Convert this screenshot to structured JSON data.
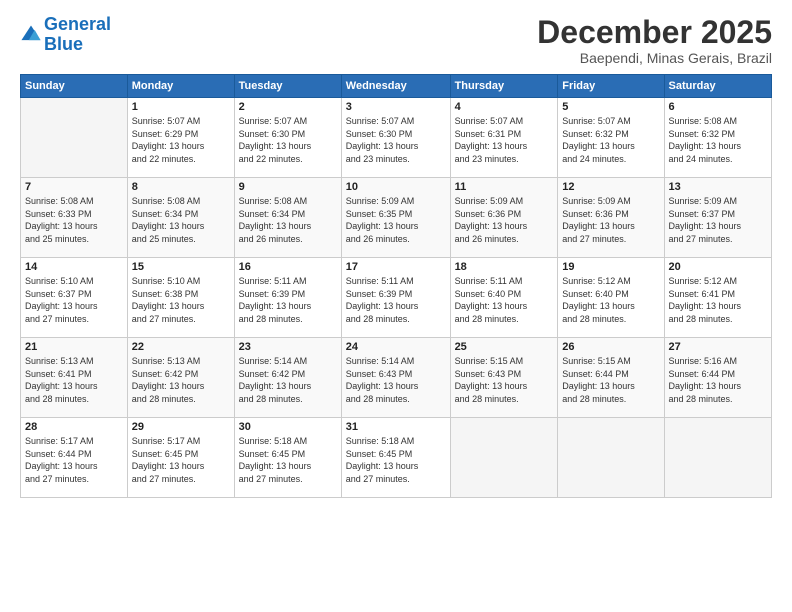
{
  "logo": {
    "line1": "General",
    "line2": "Blue"
  },
  "header": {
    "month": "December 2025",
    "location": "Baependi, Minas Gerais, Brazil"
  },
  "days_of_week": [
    "Sunday",
    "Monday",
    "Tuesday",
    "Wednesday",
    "Thursday",
    "Friday",
    "Saturday"
  ],
  "weeks": [
    [
      {
        "day": "",
        "info": ""
      },
      {
        "day": "1",
        "info": "Sunrise: 5:07 AM\nSunset: 6:29 PM\nDaylight: 13 hours\nand 22 minutes."
      },
      {
        "day": "2",
        "info": "Sunrise: 5:07 AM\nSunset: 6:30 PM\nDaylight: 13 hours\nand 22 minutes."
      },
      {
        "day": "3",
        "info": "Sunrise: 5:07 AM\nSunset: 6:30 PM\nDaylight: 13 hours\nand 23 minutes."
      },
      {
        "day": "4",
        "info": "Sunrise: 5:07 AM\nSunset: 6:31 PM\nDaylight: 13 hours\nand 23 minutes."
      },
      {
        "day": "5",
        "info": "Sunrise: 5:07 AM\nSunset: 6:32 PM\nDaylight: 13 hours\nand 24 minutes."
      },
      {
        "day": "6",
        "info": "Sunrise: 5:08 AM\nSunset: 6:32 PM\nDaylight: 13 hours\nand 24 minutes."
      }
    ],
    [
      {
        "day": "7",
        "info": "Sunrise: 5:08 AM\nSunset: 6:33 PM\nDaylight: 13 hours\nand 25 minutes."
      },
      {
        "day": "8",
        "info": "Sunrise: 5:08 AM\nSunset: 6:34 PM\nDaylight: 13 hours\nand 25 minutes."
      },
      {
        "day": "9",
        "info": "Sunrise: 5:08 AM\nSunset: 6:34 PM\nDaylight: 13 hours\nand 26 minutes."
      },
      {
        "day": "10",
        "info": "Sunrise: 5:09 AM\nSunset: 6:35 PM\nDaylight: 13 hours\nand 26 minutes."
      },
      {
        "day": "11",
        "info": "Sunrise: 5:09 AM\nSunset: 6:36 PM\nDaylight: 13 hours\nand 26 minutes."
      },
      {
        "day": "12",
        "info": "Sunrise: 5:09 AM\nSunset: 6:36 PM\nDaylight: 13 hours\nand 27 minutes."
      },
      {
        "day": "13",
        "info": "Sunrise: 5:09 AM\nSunset: 6:37 PM\nDaylight: 13 hours\nand 27 minutes."
      }
    ],
    [
      {
        "day": "14",
        "info": "Sunrise: 5:10 AM\nSunset: 6:37 PM\nDaylight: 13 hours\nand 27 minutes."
      },
      {
        "day": "15",
        "info": "Sunrise: 5:10 AM\nSunset: 6:38 PM\nDaylight: 13 hours\nand 27 minutes."
      },
      {
        "day": "16",
        "info": "Sunrise: 5:11 AM\nSunset: 6:39 PM\nDaylight: 13 hours\nand 28 minutes."
      },
      {
        "day": "17",
        "info": "Sunrise: 5:11 AM\nSunset: 6:39 PM\nDaylight: 13 hours\nand 28 minutes."
      },
      {
        "day": "18",
        "info": "Sunrise: 5:11 AM\nSunset: 6:40 PM\nDaylight: 13 hours\nand 28 minutes."
      },
      {
        "day": "19",
        "info": "Sunrise: 5:12 AM\nSunset: 6:40 PM\nDaylight: 13 hours\nand 28 minutes."
      },
      {
        "day": "20",
        "info": "Sunrise: 5:12 AM\nSunset: 6:41 PM\nDaylight: 13 hours\nand 28 minutes."
      }
    ],
    [
      {
        "day": "21",
        "info": "Sunrise: 5:13 AM\nSunset: 6:41 PM\nDaylight: 13 hours\nand 28 minutes."
      },
      {
        "day": "22",
        "info": "Sunrise: 5:13 AM\nSunset: 6:42 PM\nDaylight: 13 hours\nand 28 minutes."
      },
      {
        "day": "23",
        "info": "Sunrise: 5:14 AM\nSunset: 6:42 PM\nDaylight: 13 hours\nand 28 minutes."
      },
      {
        "day": "24",
        "info": "Sunrise: 5:14 AM\nSunset: 6:43 PM\nDaylight: 13 hours\nand 28 minutes."
      },
      {
        "day": "25",
        "info": "Sunrise: 5:15 AM\nSunset: 6:43 PM\nDaylight: 13 hours\nand 28 minutes."
      },
      {
        "day": "26",
        "info": "Sunrise: 5:15 AM\nSunset: 6:44 PM\nDaylight: 13 hours\nand 28 minutes."
      },
      {
        "day": "27",
        "info": "Sunrise: 5:16 AM\nSunset: 6:44 PM\nDaylight: 13 hours\nand 28 minutes."
      }
    ],
    [
      {
        "day": "28",
        "info": "Sunrise: 5:17 AM\nSunset: 6:44 PM\nDaylight: 13 hours\nand 27 minutes."
      },
      {
        "day": "29",
        "info": "Sunrise: 5:17 AM\nSunset: 6:45 PM\nDaylight: 13 hours\nand 27 minutes."
      },
      {
        "day": "30",
        "info": "Sunrise: 5:18 AM\nSunset: 6:45 PM\nDaylight: 13 hours\nand 27 minutes."
      },
      {
        "day": "31",
        "info": "Sunrise: 5:18 AM\nSunset: 6:45 PM\nDaylight: 13 hours\nand 27 minutes."
      },
      {
        "day": "",
        "info": ""
      },
      {
        "day": "",
        "info": ""
      },
      {
        "day": "",
        "info": ""
      }
    ]
  ]
}
